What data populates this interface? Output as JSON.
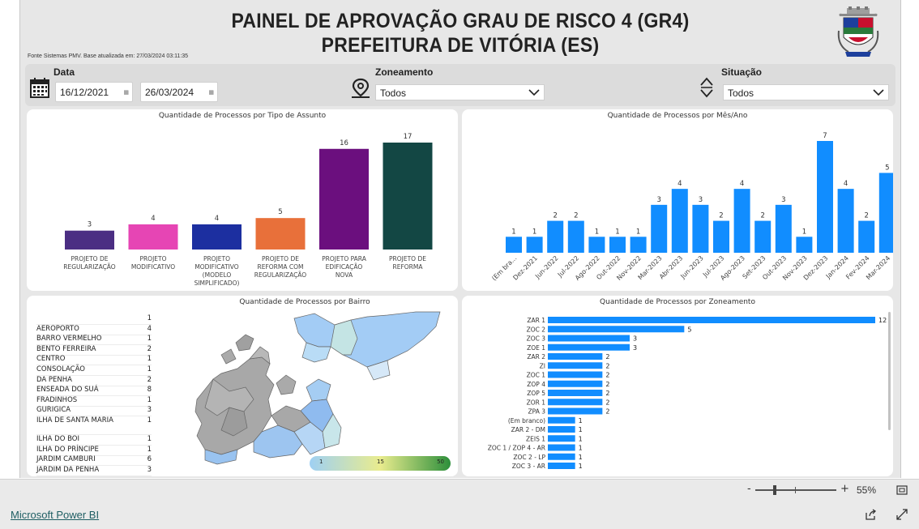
{
  "header": {
    "title_line1": "PAINEL DE APROVAÇÃO GRAU DE RISCO 4 (GR4)",
    "title_line2": "PREFEITURA DE VITÓRIA (ES)",
    "source_note": "Fonte Sistemas PMV. Base atualizada em: 27/03/2024 03:11:35"
  },
  "filters": {
    "date_label": "Data",
    "date_start": "16/12/2021",
    "date_end": "26/03/2024",
    "zoning_label": "Zoneamento",
    "zoning_value": "Todos",
    "situation_label": "Situação",
    "situation_value": "Todos"
  },
  "charts": {
    "by_type": {
      "title": "Quantidade de Processos por Tipo de Assunto",
      "chart_data": {
        "type": "bar",
        "categories": [
          "PROJETO DE REGULARIZAÇÃO",
          "PROJETO MODIFICATIVO",
          "PROJETO MODIFICATIVO (MODELO SIMPLIFICADO)",
          "PROJETO DE REFORMA COM REGULARIZAÇÃO",
          "PROJETO PARA EDIFICAÇÃO NOVA",
          "PROJETO DE REFORMA"
        ],
        "category_lines": [
          [
            "PROJETO DE",
            "REGULARIZAÇÃO"
          ],
          [
            "PROJETO",
            "MODIFICATIVO"
          ],
          [
            "PROJETO",
            "MODIFICATIVO",
            "(MODELO",
            "SIMPLIFICADO)"
          ],
          [
            "PROJETO DE",
            "REFORMA COM",
            "REGULARIZAÇÃO"
          ],
          [
            "PROJETO PARA",
            "EDIFICAÇÃO",
            "NOVA"
          ],
          [
            "PROJETO DE",
            "REFORMA"
          ]
        ],
        "values": [
          3,
          4,
          4,
          5,
          16,
          17
        ],
        "colors": [
          "#4b2e83",
          "#e645b4",
          "#1c2fa0",
          "#e8703a",
          "#6b0f7e",
          "#134744"
        ]
      }
    },
    "by_month": {
      "title": "Quantidade de Processos por Mês/Ano",
      "chart_data": {
        "type": "bar",
        "categories": [
          "(Em bra...",
          "Dez-2021",
          "Jun-2022",
          "Jul-2022",
          "Ago-2022",
          "Out-2022",
          "Nov-2022",
          "Mar-2023",
          "Abr-2023",
          "Jun-2023",
          "Jul-2023",
          "Ago-2023",
          "Set-2023",
          "Out-2023",
          "Nov-2023",
          "Dez-2023",
          "Jan-2024",
          "Fev-2024",
          "Mar-2024"
        ],
        "values": [
          1,
          1,
          2,
          2,
          1,
          1,
          1,
          3,
          4,
          3,
          2,
          4,
          2,
          3,
          1,
          7,
          4,
          2,
          5
        ],
        "color": "#118dff"
      }
    },
    "by_neighborhood": {
      "title": "Quantidade de Processos por Bairro",
      "rows": [
        {
          "name": "",
          "value": "1"
        },
        {
          "name": "AEROPORTO",
          "value": "4"
        },
        {
          "name": "BARRO VERMELHO",
          "value": "1"
        },
        {
          "name": "BENTO FERREIRA",
          "value": "2"
        },
        {
          "name": "CENTRO",
          "value": "1"
        },
        {
          "name": "CONSOLAÇÃO",
          "value": "1"
        },
        {
          "name": "DA PENHA",
          "value": "2"
        },
        {
          "name": "ENSEADA DO SUÁ",
          "value": "8"
        },
        {
          "name": "FRADINHOS",
          "value": "1"
        },
        {
          "name": "GURIGICA",
          "value": "3"
        },
        {
          "name": "ILHA DE SANTA MARIA",
          "value": "1"
        },
        {
          "name": "ILHA DO BOI",
          "value": "1"
        },
        {
          "name": "ILHA DO PRÍNCIPE",
          "value": "1"
        },
        {
          "name": "JARDIM CAMBURI",
          "value": "6"
        },
        {
          "name": "JARDIM DA PENHA",
          "value": "3"
        }
      ],
      "legend_min": "1",
      "legend_mid": "15",
      "legend_max": "50"
    },
    "by_zoning": {
      "title": "Quantidade de Processos por Zoneamento",
      "chart_data": {
        "type": "bar",
        "orientation": "horizontal",
        "categories": [
          "ZAR 1",
          "ZOC 2",
          "ZOC 3",
          "ZOE 1",
          "ZAR 2",
          "ZI",
          "ZOC 1",
          "ZOP 4",
          "ZOP 5",
          "ZOR 1",
          "ZPA 3",
          "(Em branco)",
          "ZAR 2 - DM",
          "ZEIS 1",
          "ZOC 1 / ZOP 4 - AR",
          "ZOC 2 - LP",
          "ZOC 3 - AR"
        ],
        "values": [
          12,
          5,
          3,
          3,
          2,
          2,
          2,
          2,
          2,
          2,
          2,
          1,
          1,
          1,
          1,
          1,
          1
        ],
        "color": "#118dff"
      }
    }
  },
  "footer": {
    "zoom_minus": "-",
    "zoom_plus": "+",
    "zoom_level": "55%",
    "power_bi_link": "Microsoft Power BI"
  }
}
